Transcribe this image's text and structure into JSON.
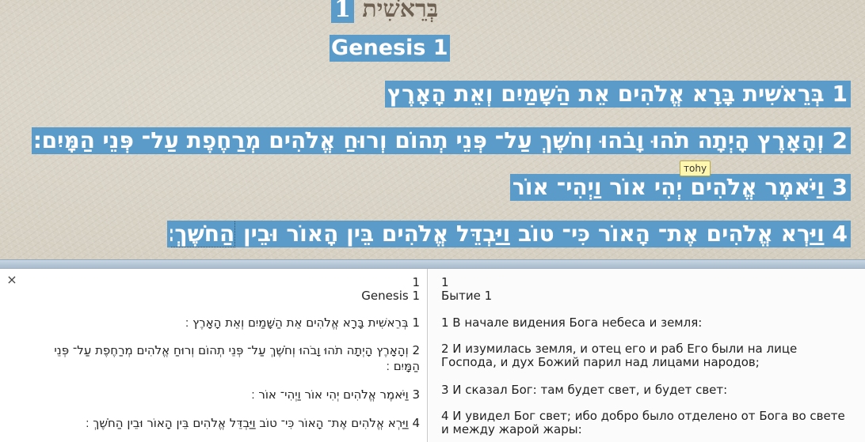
{
  "reader": {
    "hebrew_title_number": "1",
    "hebrew_title_word": "בְּרֵאשִׁית",
    "english_title": "Genesis 1",
    "verses": [
      "1 בְּרֵאשִׁית בָּרָא אֱלֹהִים אֵת הַשָּׁמַיִם וְאֵת הָאָרֶץ׃",
      "2 וְהָאָרֶץ הָיְתָה תֹהוּ וָבֹהוּ וְחֹשֶׁךְ עַל־ פְּנֵי תְהוֹם וְרוּחַ אֱלֹהִים מְרַחֶפֶת עַל־ פְּנֵי הַמָּיִם׃",
      "3 וַיֹּאמֶר אֱלֹהִים יְהִי אוֹר וַיְהִי־ אוֹר׃",
      "4 וַיַּרְא אֱלֹהִים אֶת־ הָאוֹר כִּי־ טוֹב וַיַּבְדֵּל אֱלֹהִים בֵּין הָאוֹר וּבֵין",
      "הַחֹשֶׁךְ׃"
    ],
    "tooltip": "тоhy"
  },
  "left_pane": {
    "close_symbol": "×",
    "chapter_number": "1",
    "chapter_title": "Genesis 1",
    "verses": [
      "1 בְּרֵאשִׁית בָּרָא אֱלֹהִים אֵת הַשָּׁמַיִם וְאֵת הָאָרֶץ ׃",
      "2 וְהָאָרֶץ הָיְתָה תֹהוּ וָבֹהוּ וְחֹשֶׁךְ עַל־ פְּנֵי תְהוֹם וְרוּחַ אֱלֹהִים מְרַחֶפֶת עַל־ פְּנֵי הַמָּיִם ׃",
      "3 וַיֹּאמֶר אֱלֹהִים יְהִי אוֹר וַיְהִי־ אוֹר ׃",
      "4 וַיַּרְא אֱלֹהִים אֶת־ הָאוֹר כִּי־ טוֹב וַיַּבְדֵּל אֱלֹהִים בֵּין הָאוֹר וּבֵין הַחֹשֶׁךְ ׃"
    ]
  },
  "right_pane": {
    "chapter_number": "1",
    "chapter_title": "Бытие 1",
    "verses": [
      "1 В начале видения Бога небеса и земля:",
      "2 И изумилась земля, и отец его и раб Его были на лице Господа, и дух Божий парил над лицами народов;",
      "3 И сказал Бог: там будет свет, и будет свет:",
      "4 И увидел Бог свет; ибо добро было отделено от Бога во свете и между жарой жары:"
    ]
  },
  "colors": {
    "selection": "#5a9bc9",
    "parchment": "#d9d4c7",
    "title_brown": "#6e6152"
  }
}
